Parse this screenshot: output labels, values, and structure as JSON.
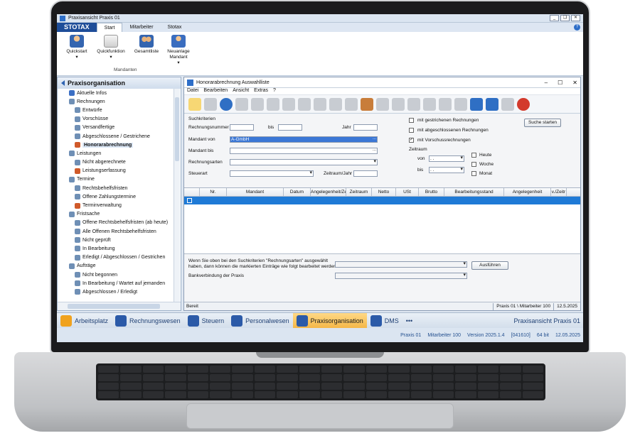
{
  "window": {
    "title": "Praxisansicht Praxis 01",
    "controls": [
      "_",
      "❑",
      "✕"
    ]
  },
  "ribbon": {
    "logo": "STOTAX",
    "tabs": [
      "Start",
      "Mitarbeiter",
      "Stotax"
    ],
    "buttons": [
      {
        "label": "Quickstart",
        "icon": "person-run-icon"
      },
      {
        "label": "Quickfunktion",
        "icon": "clipboard-icon"
      },
      {
        "label": "Gesamtliste",
        "icon": "people-icon"
      },
      {
        "label": "Neuanlage Mandant",
        "icon": "person-add-icon"
      }
    ],
    "group_label": "Mandanten"
  },
  "sidebar": {
    "title": "Praxisorganisation",
    "items": [
      {
        "label": "Aktuelle Infos",
        "level": 1,
        "color": "#3b6fc4"
      },
      {
        "label": "Rechnungen",
        "level": 1,
        "color": "#6f8fb5"
      },
      {
        "label": "Entwürfe",
        "level": 2,
        "color": "#6f8fb5"
      },
      {
        "label": "Vorschüsse",
        "level": 2,
        "color": "#6f8fb5"
      },
      {
        "label": "Versandfertige",
        "level": 2,
        "color": "#6f8fb5"
      },
      {
        "label": "Abgeschlossene / Gestrichene",
        "level": 2,
        "color": "#6f8fb5"
      },
      {
        "label": "Honorarabrechnung",
        "level": 2,
        "color": "#d05a2a",
        "selected": true
      },
      {
        "label": "Leistungen",
        "level": 1,
        "color": "#6f8fb5"
      },
      {
        "label": "Nicht abgerechnete",
        "level": 2,
        "color": "#6f8fb5"
      },
      {
        "label": "Leistungserfassung",
        "level": 2,
        "color": "#d05a2a"
      },
      {
        "label": "Termine",
        "level": 1,
        "color": "#6f8fb5"
      },
      {
        "label": "Rechtsbehelfsfristen",
        "level": 2,
        "color": "#6f8fb5"
      },
      {
        "label": "Offene Zahlungstermine",
        "level": 2,
        "color": "#6f8fb5"
      },
      {
        "label": "Terminverwaltung",
        "level": 2,
        "color": "#d05a2a"
      },
      {
        "label": "Fristsache",
        "level": 1,
        "color": "#6f8fb5"
      },
      {
        "label": "Offene Rechtsbehelfsfristen (ab heute)",
        "level": 2,
        "color": "#6f8fb5"
      },
      {
        "label": "Alle Offenen Rechtsbehelfsfristen",
        "level": 2,
        "color": "#6f8fb5"
      },
      {
        "label": "Nicht geprüft",
        "level": 2,
        "color": "#6f8fb5"
      },
      {
        "label": "In Bearbeitung",
        "level": 2,
        "color": "#6f8fb5"
      },
      {
        "label": "Erledigt / Abgeschlossen / Gestrichen",
        "level": 2,
        "color": "#6f8fb5"
      },
      {
        "label": "Aufträge",
        "level": 1,
        "color": "#6f8fb5"
      },
      {
        "label": "Nicht begonnen",
        "level": 2,
        "color": "#6f8fb5"
      },
      {
        "label": "In Bearbeitung / Wartet auf jemanden",
        "level": 2,
        "color": "#6f8fb5"
      },
      {
        "label": "Abgeschlossen / Erledigt",
        "level": 2,
        "color": "#6f8fb5"
      }
    ]
  },
  "child_window": {
    "title": "Honorarabrechnung Auswahlliste",
    "menu": [
      "Datei",
      "Bearbeiten",
      "Ansicht",
      "Extras",
      "?"
    ],
    "search": {
      "section": "Suchkriterien",
      "rechnungsnummer": "Rechnungsnummer",
      "bis": "bis",
      "jahr": "Jahr",
      "mandant_von": "Mandant von",
      "mandant_von_value": "A-GmbH",
      "mandant_bis": "Mandant bis",
      "rechnungsarten": "Rechnungsarten",
      "steuerart": "Steuerart",
      "zeitraum_jahr": "Zeitraum/Jahr",
      "ellipsis": "...",
      "chk_gestrichen": "mit gestrichenen Rechnungen",
      "chk_abgeschlossen": "mit abgeschlossenen Rechnungen",
      "chk_vorschuss": "mit Vorschussrechnungen",
      "zeitraum": "Zeitraum",
      "von": "von",
      "bis2": "bis",
      "date_placeholder": ". .",
      "heute": "Heute",
      "woche": "Woche",
      "monat": "Monat",
      "suche_button": "Suche starten"
    },
    "grid": {
      "columns": [
        "",
        "Nr.",
        "Mandant",
        "Datum",
        "Angelegenheit/Zeitraum",
        "Zeitraum",
        "Netto",
        "USt",
        "Brutto",
        "Bearbeitungsstand",
        "Angelegenheit",
        "v./Zeitr"
      ]
    },
    "bottom": {
      "info_line1": "Wenn Sie oben bei den Suchkriterien \"Rechnungsarten\" ausgewählt",
      "info_line2": "haben, dann können die markierten Einträge wie folgt bearbeitet werden",
      "bank": "Bankverbindung der Praxis",
      "ausfuehren": "Ausführen"
    },
    "status": {
      "left": "Bereit",
      "user": "Praxis 01 \\ Mitarbeiter 100",
      "date": "12.5.2025"
    }
  },
  "navbar": {
    "items": [
      {
        "label": "Arbeitsplatz",
        "icon": "monitor-icon"
      },
      {
        "label": "Rechnungswesen",
        "icon": "calculator-icon"
      },
      {
        "label": "Steuern",
        "icon": "eagle-icon"
      },
      {
        "label": "Personalwesen",
        "icon": "people-icon"
      },
      {
        "label": "Praxisorganisation",
        "icon": "gear-icon",
        "active": true
      },
      {
        "label": "DMS",
        "icon": "dms-icon"
      },
      {
        "label": "•••",
        "icon": ""
      }
    ],
    "right": "Praxisansicht Praxis 01"
  },
  "statusbar": {
    "praxis": "Praxis 01",
    "mitarbeiter": "Mitarbeiter 100",
    "version": "Version 2025.1.4",
    "build": "[041610]",
    "bits": "64 bit",
    "date": "12.05.2025"
  }
}
